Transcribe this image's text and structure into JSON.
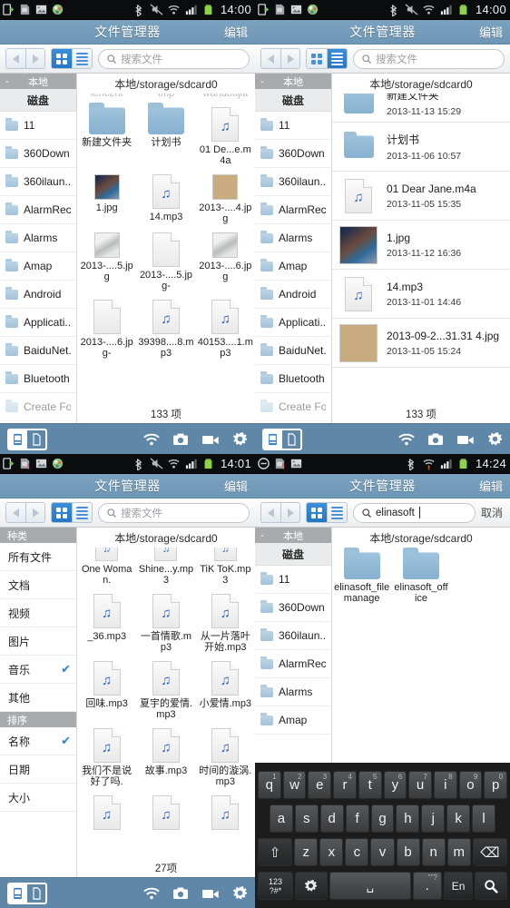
{
  "app": {
    "title": "文件管理器",
    "edit_label": "编辑",
    "breadcrumb": "本地/storage/sdcard0"
  },
  "search": {
    "placeholder": "搜索文件",
    "query_value": "elinasoft",
    "cancel_label": "取消",
    "icon": "search-icon"
  },
  "toolbar": {
    "back_icon": "triangle-left-icon",
    "forward_icon": "triangle-right-icon",
    "grid_view_icon": "grid-view-icon",
    "list_view_icon": "list-view-icon"
  },
  "bottom_bar": {
    "tab_device_icon": "device-tab-icon",
    "tab_file_icon": "file-tab-icon",
    "wifi_icon": "wifi-icon",
    "camera_icon": "camera-icon",
    "video_icon": "video-camera-icon",
    "settings_icon": "gear-icon"
  },
  "colors": {
    "title_bar": "#6e97b6",
    "bottom_bar": "#5f88a8",
    "accent_blue": "#2477c4",
    "check_blue": "#2f82d5",
    "sidebar_header": "#a8abae"
  },
  "panels": [
    {
      "id": "panel-grid-local",
      "status_bar": {
        "time": "14:00",
        "left_icons": [
          "usb-debug-icon",
          "sd-card-icon",
          "screenshot-icon",
          "app-icon"
        ],
        "right_icons": [
          "bluetooth-icon",
          "mute-icon",
          "wifi-icon",
          "signal-icon",
          "battery-icon"
        ]
      },
      "active_view": "grid",
      "search_state": "placeholder",
      "sidebar": {
        "header": "本地",
        "header_collapse": "-",
        "subheader": "磁盘",
        "items": [
          {
            "label": "11"
          },
          {
            "label": "360Down..."
          },
          {
            "label": "360ilaun..."
          },
          {
            "label": "AlarmRec..."
          },
          {
            "label": "Alarms"
          },
          {
            "label": "Amap"
          },
          {
            "label": "Android"
          },
          {
            "label": "Applicati..."
          },
          {
            "label": "BaiduNet..."
          },
          {
            "label": "Bluetooth"
          },
          {
            "label": "Create Fo"
          }
        ]
      },
      "grid": {
        "ghost_row": [
          "tencent",
          "tmp",
          "wandoujia"
        ],
        "items": [
          {
            "name": "新建文件夹",
            "icon": "folder-icon"
          },
          {
            "name": "计划书",
            "icon": "folder-icon"
          },
          {
            "name": "01 De...e.m4a",
            "icon": "audio-file-icon"
          },
          {
            "name": "1.jpg",
            "icon": "image-thumb-photo"
          },
          {
            "name": "14.mp3",
            "icon": "audio-file-icon"
          },
          {
            "name": "2013-....4.jpg",
            "icon": "image-thumb-beige"
          },
          {
            "name": "2013-....5.jpg",
            "icon": "image-thumb-car"
          },
          {
            "name": "2013-....5.jpg-",
            "icon": "blank-file-icon"
          },
          {
            "name": "2013-....6.jpg",
            "icon": "image-thumb-car"
          },
          {
            "name": "2013-....6.jpg-",
            "icon": "blank-file-icon"
          },
          {
            "name": "39398....8.mp3",
            "icon": "audio-file-icon"
          },
          {
            "name": "40153....1.mp3",
            "icon": "audio-file-icon"
          }
        ],
        "count": "133 项"
      }
    },
    {
      "id": "panel-list-local",
      "status_bar": {
        "time": "14:00",
        "left_icons": [
          "usb-debug-icon",
          "sd-card-icon",
          "screenshot-icon",
          "app-icon"
        ],
        "right_icons": [
          "bluetooth-icon",
          "mute-icon",
          "wifi-icon",
          "signal-icon",
          "battery-icon"
        ]
      },
      "active_view": "list",
      "search_state": "placeholder",
      "sidebar": {
        "header": "本地",
        "header_collapse": "-",
        "subheader": "磁盘",
        "items": [
          {
            "label": "11"
          },
          {
            "label": "360Down..."
          },
          {
            "label": "360ilaun..."
          },
          {
            "label": "AlarmRec..."
          },
          {
            "label": "Alarms"
          },
          {
            "label": "Amap"
          },
          {
            "label": "Android"
          },
          {
            "label": "Applicati..."
          },
          {
            "label": "BaiduNet..."
          },
          {
            "label": "Bluetooth"
          },
          {
            "label": "Create Fo"
          }
        ]
      },
      "list": {
        "rows": [
          {
            "name": "新建文件夹",
            "date": "2013-11-13 15:29",
            "icon": "folder-icon"
          },
          {
            "name": "计划书",
            "date": "2013-11-06 10:57",
            "icon": "folder-icon"
          },
          {
            "name": "01 Dear Jane.m4a",
            "date": "2013-11-05 15:35",
            "icon": "audio-file-icon"
          },
          {
            "name": "1.jpg",
            "date": "2013-11-12 16:36",
            "icon": "image-thumb-photo"
          },
          {
            "name": "14.mp3",
            "date": "2013-11-01 14:46",
            "icon": "audio-file-icon"
          },
          {
            "name": "2013-09-2...31.31 4.jpg",
            "date": "2013-11-05 15:24",
            "icon": "image-thumb-beige"
          }
        ],
        "count": "133 项"
      }
    },
    {
      "id": "panel-music-category",
      "status_bar": {
        "time": "14:01",
        "left_icons": [
          "usb-debug-icon",
          "sd-card-alert-icon",
          "screenshot-icon",
          "app-icon"
        ],
        "right_icons": [
          "bluetooth-icon",
          "mute-icon",
          "wifi-icon",
          "signal-icon",
          "battery-icon"
        ]
      },
      "active_view": "grid",
      "search_state": "placeholder",
      "sidebar": {
        "category_header": "种类",
        "categories": [
          {
            "label": "所有文件",
            "checked": false
          },
          {
            "label": "文档",
            "checked": false
          },
          {
            "label": "视频",
            "checked": false
          },
          {
            "label": "图片",
            "checked": false
          },
          {
            "label": "音乐",
            "checked": true
          },
          {
            "label": "其他",
            "checked": false
          }
        ],
        "sort_header": "排序",
        "sorts": [
          {
            "label": "名称",
            "checked": true
          },
          {
            "label": "日期",
            "checked": false
          },
          {
            "label": "大小",
            "checked": false
          }
        ]
      },
      "grid": {
        "ghost_row": [],
        "items": [
          {
            "name": "One Woman.",
            "icon": "audio-file-icon-faded"
          },
          {
            "name": "Shine...y.mp3",
            "icon": "audio-file-icon-faded"
          },
          {
            "name": "TiK ToK.mp3",
            "icon": "audio-file-icon-faded"
          },
          {
            "name": "_36.mp3",
            "icon": "audio-file-icon"
          },
          {
            "name": "一首情歌.mp3",
            "icon": "audio-file-icon"
          },
          {
            "name": "从一片落叶开始.mp3",
            "icon": "audio-file-icon"
          },
          {
            "name": "回味.mp3",
            "icon": "audio-file-icon"
          },
          {
            "name": "夏宇的爱情.mp3",
            "icon": "audio-file-icon"
          },
          {
            "name": "小爱情.mp3",
            "icon": "audio-file-icon"
          },
          {
            "name": "我们不是说好了吗.",
            "icon": "audio-file-icon"
          },
          {
            "name": "故事.mp3",
            "icon": "audio-file-icon"
          },
          {
            "name": "时间的漩涡.mp3",
            "icon": "audio-file-icon"
          }
        ],
        "count": "27项"
      }
    },
    {
      "id": "panel-search-results",
      "status_bar": {
        "time": "14:24",
        "left_icons": [
          "do-not-disturb-icon",
          "sd-card-alert-icon",
          "screenshot-icon"
        ],
        "right_icons": [
          "bluetooth-icon",
          "wifi-alert-icon",
          "signal-icon",
          "battery-icon"
        ]
      },
      "active_view": "grid",
      "search_state": "typed",
      "sidebar": {
        "header": "本地",
        "header_collapse": "-",
        "subheader": "磁盘",
        "items": [
          {
            "label": "11"
          },
          {
            "label": "360Down..."
          },
          {
            "label": "360ilaun..."
          },
          {
            "label": "AlarmRec..."
          },
          {
            "label": "Alarms"
          },
          {
            "label": "Amap"
          }
        ]
      },
      "grid": {
        "ghost_row": [],
        "items": [
          {
            "name": "elinasoft_filemanage",
            "icon": "folder-icon"
          },
          {
            "name": "elinasoft_office",
            "icon": "folder-icon"
          }
        ],
        "count": ""
      },
      "keyboard": {
        "row1": [
          {
            "key": "q",
            "sup": "1"
          },
          {
            "key": "w",
            "sup": "2"
          },
          {
            "key": "e",
            "sup": "3"
          },
          {
            "key": "r",
            "sup": "4"
          },
          {
            "key": "t",
            "sup": "5"
          },
          {
            "key": "y",
            "sup": "6"
          },
          {
            "key": "u",
            "sup": "7"
          },
          {
            "key": "i",
            "sup": "8"
          },
          {
            "key": "o",
            "sup": "9"
          },
          {
            "key": "p",
            "sup": "0"
          }
        ],
        "row2": [
          {
            "key": "a"
          },
          {
            "key": "s"
          },
          {
            "key": "d"
          },
          {
            "key": "f"
          },
          {
            "key": "g"
          },
          {
            "key": "h"
          },
          {
            "key": "j"
          },
          {
            "key": "k"
          },
          {
            "key": "l"
          }
        ],
        "row3": [
          {
            "key": "⇧",
            "name": "shift-key"
          },
          {
            "key": "z"
          },
          {
            "key": "x"
          },
          {
            "key": "c"
          },
          {
            "key": "v"
          },
          {
            "key": "b"
          },
          {
            "key": "n"
          },
          {
            "key": "m"
          },
          {
            "key": "⌫",
            "name": "backspace-key"
          }
        ],
        "row4": {
          "numeric": "123\n?#*",
          "settings_icon": "gear-icon",
          "space": "␣",
          "period": ".",
          "period_sup": "\"\"?",
          "lang": "En",
          "search_icon": "search-icon"
        }
      }
    }
  ]
}
